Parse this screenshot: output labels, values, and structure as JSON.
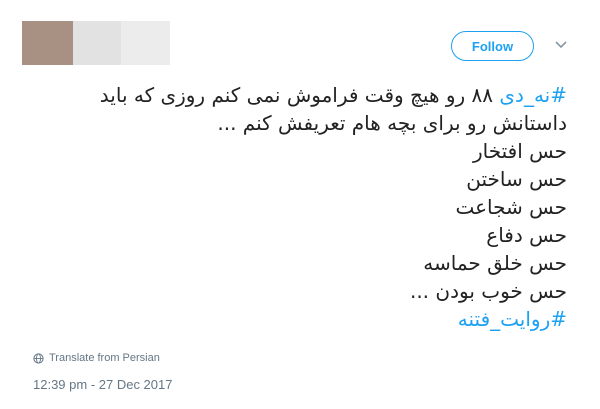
{
  "tweet": {
    "follow_label": "Follow",
    "lines": [
      {
        "hashtag": "#نه_دی",
        "text": " ۸۸ رو هیچ وقت فراموش نمی کنم روزی که باید"
      },
      {
        "text": "داستانش رو برای بچه هام تعریفش کنم ..."
      },
      {
        "text": "حس افتخار"
      },
      {
        "text": "حس ساختن"
      },
      {
        "text": "حس شجاعت"
      },
      {
        "text": "حس دفاع"
      },
      {
        "text": "حس خلق حماسه"
      },
      {
        "text": "حس خوب بودن ..."
      }
    ],
    "closing_hashtag": "#روایت_فتنه",
    "translate_label": "Translate from Persian",
    "timestamp": "12:39 pm - 27 Dec 2017"
  },
  "colors": {
    "accent": "#1da1f2",
    "text": "#222222",
    "muted": "#657786"
  },
  "icons": {
    "menu": "chevron-down-icon",
    "translate": "globe-icon"
  }
}
